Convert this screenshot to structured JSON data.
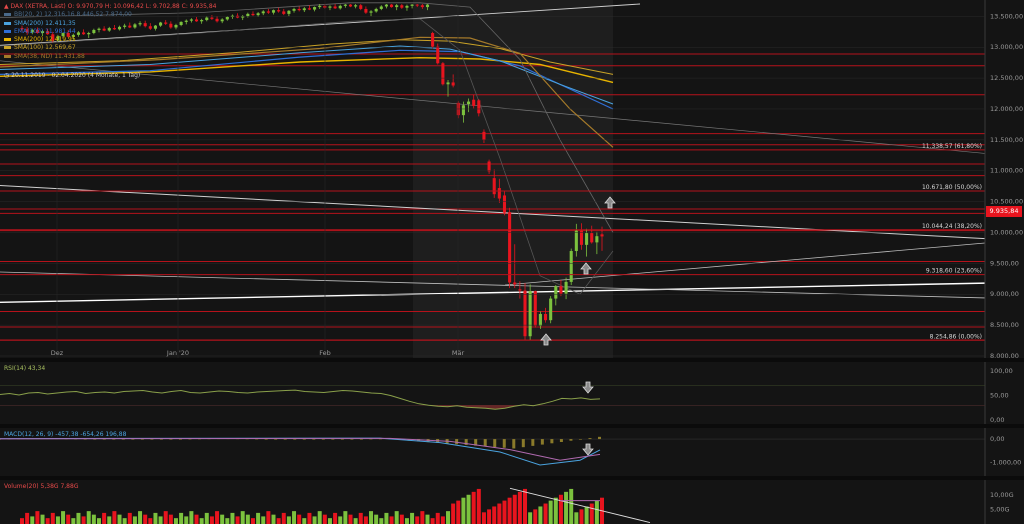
{
  "instrument_line": "DAX (XETRA, Last)  O: 9.970,79  H: 10.096,42  L: 9.702,88  C: 9.935,84",
  "legend": [
    {
      "label": "BB(20, 2)  12.316,16  8.446,52  7.874,00",
      "color": "#4a6a8a"
    },
    {
      "label": "SMA(200)  12.411,35",
      "color": "#4aa3df"
    },
    {
      "label": "EMA(100)  11.981,44",
      "color": "#2f6fd6"
    },
    {
      "label": "SMA(200)  12.419,95",
      "color": "#e8b400"
    },
    {
      "label": "SMA(100)  12.569,67",
      "color": "#c9a227"
    },
    {
      "label": "SMA(38, ND)  11.431,88",
      "color": "#a57a2a"
    }
  ],
  "period": "20.11.2019 - 02.04.2020   (4 Monate, 1 Tag)",
  "last_price": "9.935,84",
  "colors": {
    "up": "#7cc23e",
    "down": "#e8141e",
    "background": "#141414",
    "grid": "#2a2a2a",
    "hline": "#b5121b"
  },
  "chart_data": {
    "type": "candlestick",
    "y_axis_ticks": [
      "13.500,00",
      "13.000,00",
      "12.500,00",
      "12.000,00",
      "11.500,00",
      "11.000,00",
      "10.500,00",
      "10.000,00",
      "9.500,00",
      "9.000,00",
      "8.500,00",
      "8.000,00"
    ],
    "ylim": [
      8000,
      13700
    ],
    "x_axis_labels": [
      "Dez",
      "Jan '20",
      "Feb",
      "Mär"
    ],
    "fib_levels": [
      {
        "value": 11338.57,
        "label": "11.338,57 (61,80%)"
      },
      {
        "value": 10671.8,
        "label": "10.671,80 (50,00%)"
      },
      {
        "value": 10044.24,
        "label": "10.044,24 (38,20%)"
      },
      {
        "value": 9318.6,
        "label": "9.318,60 (23,60%)"
      },
      {
        "value": 8254.86,
        "label": "8.254,86 (0,00%)"
      }
    ],
    "support_resistance_levels": [
      12890,
      12700,
      12230,
      11600,
      11420,
      11110,
      10920,
      10380,
      10310,
      10030,
      9530,
      8720,
      8470,
      8260
    ],
    "candles": [
      {
        "o": 13310,
        "h": 13350,
        "l": 13250,
        "c": 13290
      },
      {
        "o": 13290,
        "h": 13330,
        "l": 13200,
        "c": 13240
      },
      {
        "o": 13240,
        "h": 13300,
        "l": 13210,
        "c": 13280
      },
      {
        "o": 13280,
        "h": 13320,
        "l": 13220,
        "c": 13230
      },
      {
        "o": 13230,
        "h": 13280,
        "l": 13180,
        "c": 13260
      },
      {
        "o": 13260,
        "h": 13300,
        "l": 13200,
        "c": 13210
      },
      {
        "o": 13210,
        "h": 13250,
        "l": 13080,
        "c": 13110
      },
      {
        "o": 13110,
        "h": 13200,
        "l": 13090,
        "c": 13180
      },
      {
        "o": 13180,
        "h": 13240,
        "l": 13150,
        "c": 13230
      },
      {
        "o": 13230,
        "h": 13280,
        "l": 13160,
        "c": 13170
      },
      {
        "o": 13170,
        "h": 13220,
        "l": 13120,
        "c": 13200
      },
      {
        "o": 13200,
        "h": 13260,
        "l": 13170,
        "c": 13240
      },
      {
        "o": 13240,
        "h": 13290,
        "l": 13200,
        "c": 13210
      },
      {
        "o": 13210,
        "h": 13250,
        "l": 13150,
        "c": 13230
      },
      {
        "o": 13230,
        "h": 13300,
        "l": 13210,
        "c": 13280
      },
      {
        "o": 13280,
        "h": 13320,
        "l": 13240,
        "c": 13300
      },
      {
        "o": 13300,
        "h": 13340,
        "l": 13260,
        "c": 13270
      },
      {
        "o": 13270,
        "h": 13330,
        "l": 13250,
        "c": 13310
      },
      {
        "o": 13310,
        "h": 13360,
        "l": 13280,
        "c": 13290
      },
      {
        "o": 13290,
        "h": 13350,
        "l": 13270,
        "c": 13330
      },
      {
        "o": 13330,
        "h": 13380,
        "l": 13300,
        "c": 13350
      },
      {
        "o": 13350,
        "h": 13400,
        "l": 13310,
        "c": 13320
      },
      {
        "o": 13320,
        "h": 13390,
        "l": 13300,
        "c": 13370
      },
      {
        "o": 13370,
        "h": 13420,
        "l": 13340,
        "c": 13390
      },
      {
        "o": 13390,
        "h": 13430,
        "l": 13320,
        "c": 13340
      },
      {
        "o": 13340,
        "h": 13390,
        "l": 13280,
        "c": 13300
      },
      {
        "o": 13300,
        "h": 13360,
        "l": 13270,
        "c": 13350
      },
      {
        "o": 13350,
        "h": 13410,
        "l": 13330,
        "c": 13400
      },
      {
        "o": 13400,
        "h": 13440,
        "l": 13360,
        "c": 13380
      },
      {
        "o": 13380,
        "h": 13420,
        "l": 13300,
        "c": 13320
      },
      {
        "o": 13320,
        "h": 13380,
        "l": 13290,
        "c": 13360
      },
      {
        "o": 13360,
        "h": 13420,
        "l": 13340,
        "c": 13410
      },
      {
        "o": 13410,
        "h": 13450,
        "l": 13370,
        "c": 13430
      },
      {
        "o": 13430,
        "h": 13470,
        "l": 13400,
        "c": 13450
      },
      {
        "o": 13450,
        "h": 13490,
        "l": 13410,
        "c": 13420
      },
      {
        "o": 13420,
        "h": 13460,
        "l": 13380,
        "c": 13440
      },
      {
        "o": 13440,
        "h": 13500,
        "l": 13420,
        "c": 13480
      },
      {
        "o": 13480,
        "h": 13520,
        "l": 13440,
        "c": 13460
      },
      {
        "o": 13460,
        "h": 13500,
        "l": 13400,
        "c": 13420
      },
      {
        "o": 13420,
        "h": 13470,
        "l": 13390,
        "c": 13450
      },
      {
        "o": 13450,
        "h": 13500,
        "l": 13430,
        "c": 13490
      },
      {
        "o": 13490,
        "h": 13530,
        "l": 13460,
        "c": 13510
      },
      {
        "o": 13510,
        "h": 13550,
        "l": 13470,
        "c": 13480
      },
      {
        "o": 13480,
        "h": 13520,
        "l": 13440,
        "c": 13500
      },
      {
        "o": 13500,
        "h": 13560,
        "l": 13480,
        "c": 13540
      },
      {
        "o": 13540,
        "h": 13580,
        "l": 13500,
        "c": 13520
      },
      {
        "o": 13520,
        "h": 13570,
        "l": 13490,
        "c": 13550
      },
      {
        "o": 13550,
        "h": 13600,
        "l": 13520,
        "c": 13580
      },
      {
        "o": 13580,
        "h": 13620,
        "l": 13540,
        "c": 13560
      },
      {
        "o": 13560,
        "h": 13610,
        "l": 13530,
        "c": 13600
      },
      {
        "o": 13600,
        "h": 13640,
        "l": 13560,
        "c": 13580
      },
      {
        "o": 13580,
        "h": 13620,
        "l": 13520,
        "c": 13540
      },
      {
        "o": 13540,
        "h": 13600,
        "l": 13500,
        "c": 13590
      },
      {
        "o": 13590,
        "h": 13640,
        "l": 13560,
        "c": 13620
      },
      {
        "o": 13620,
        "h": 13660,
        "l": 13580,
        "c": 13600
      },
      {
        "o": 13600,
        "h": 13650,
        "l": 13570,
        "c": 13630
      },
      {
        "o": 13630,
        "h": 13680,
        "l": 13600,
        "c": 13610
      },
      {
        "o": 13610,
        "h": 13660,
        "l": 13580,
        "c": 13650
      },
      {
        "o": 13650,
        "h": 13700,
        "l": 13620,
        "c": 13670
      },
      {
        "o": 13670,
        "h": 13700,
        "l": 13620,
        "c": 13640
      },
      {
        "o": 13640,
        "h": 13680,
        "l": 13600,
        "c": 13660
      },
      {
        "o": 13660,
        "h": 13700,
        "l": 13620,
        "c": 13630
      },
      {
        "o": 13630,
        "h": 13690,
        "l": 13610,
        "c": 13670
      },
      {
        "o": 13670,
        "h": 13700,
        "l": 13640,
        "c": 13690
      },
      {
        "o": 13690,
        "h": 13700,
        "l": 13650,
        "c": 13660
      },
      {
        "o": 13660,
        "h": 13700,
        "l": 13630,
        "c": 13680
      },
      {
        "o": 13680,
        "h": 13700,
        "l": 13600,
        "c": 13620
      },
      {
        "o": 13620,
        "h": 13660,
        "l": 13540,
        "c": 13560
      },
      {
        "o": 13560,
        "h": 13600,
        "l": 13500,
        "c": 13580
      },
      {
        "o": 13580,
        "h": 13640,
        "l": 13560,
        "c": 13620
      },
      {
        "o": 13620,
        "h": 13680,
        "l": 13600,
        "c": 13660
      },
      {
        "o": 13660,
        "h": 13700,
        "l": 13630,
        "c": 13690
      },
      {
        "o": 13690,
        "h": 13700,
        "l": 13640,
        "c": 13650
      },
      {
        "o": 13650,
        "h": 13700,
        "l": 13600,
        "c": 13680
      },
      {
        "o": 13680,
        "h": 13700,
        "l": 13620,
        "c": 13640
      },
      {
        "o": 13640,
        "h": 13690,
        "l": 13590,
        "c": 13670
      },
      {
        "o": 13670,
        "h": 13700,
        "l": 13630,
        "c": 13690
      },
      {
        "o": 13690,
        "h": 13700,
        "l": 13650,
        "c": 13680
      },
      {
        "o": 13680,
        "h": 13700,
        "l": 13620,
        "c": 13650
      },
      {
        "o": 13650,
        "h": 13700,
        "l": 13600,
        "c": 13690
      },
      {
        "o": 13230,
        "h": 13250,
        "l": 12980,
        "c": 13010
      },
      {
        "o": 13010,
        "h": 13060,
        "l": 12720,
        "c": 12740
      },
      {
        "o": 12740,
        "h": 12760,
        "l": 12380,
        "c": 12400
      },
      {
        "o": 12400,
        "h": 12470,
        "l": 12200,
        "c": 12430
      },
      {
        "o": 12430,
        "h": 12560,
        "l": 12350,
        "c": 12380
      },
      {
        "o": 12100,
        "h": 12130,
        "l": 11850,
        "c": 11900
      },
      {
        "o": 11900,
        "h": 12120,
        "l": 11780,
        "c": 12060
      },
      {
        "o": 12080,
        "h": 12170,
        "l": 11950,
        "c": 12120
      },
      {
        "o": 12150,
        "h": 12230,
        "l": 12010,
        "c": 12050
      },
      {
        "o": 12140,
        "h": 12160,
        "l": 11880,
        "c": 11930
      },
      {
        "o": 11630,
        "h": 11670,
        "l": 11450,
        "c": 11500
      },
      {
        "o": 11150,
        "h": 11180,
        "l": 10950,
        "c": 10990
      },
      {
        "o": 10880,
        "h": 11020,
        "l": 10560,
        "c": 10620
      },
      {
        "o": 10720,
        "h": 10870,
        "l": 10480,
        "c": 10550
      },
      {
        "o": 10600,
        "h": 10680,
        "l": 10280,
        "c": 10320
      },
      {
        "o": 10330,
        "h": 10400,
        "l": 9100,
        "c": 9190
      },
      {
        "o": 9190,
        "h": 9810,
        "l": 9100,
        "c": 9160
      },
      {
        "o": 9080,
        "h": 9210,
        "l": 8930,
        "c": 9060
      },
      {
        "o": 9060,
        "h": 9180,
        "l": 8250,
        "c": 8320
      },
      {
        "o": 8320,
        "h": 9160,
        "l": 8260,
        "c": 9050
      },
      {
        "o": 9050,
        "h": 9060,
        "l": 8460,
        "c": 8490
      },
      {
        "o": 8490,
        "h": 8720,
        "l": 8440,
        "c": 8680
      },
      {
        "o": 8680,
        "h": 8780,
        "l": 8540,
        "c": 8580
      },
      {
        "o": 8580,
        "h": 8970,
        "l": 8530,
        "c": 8930
      },
      {
        "o": 8930,
        "h": 9150,
        "l": 8820,
        "c": 9130
      },
      {
        "o": 9130,
        "h": 9230,
        "l": 8970,
        "c": 9010
      },
      {
        "o": 9010,
        "h": 9270,
        "l": 8920,
        "c": 9200
      },
      {
        "o": 9200,
        "h": 9740,
        "l": 9150,
        "c": 9700
      },
      {
        "o": 9700,
        "h": 10140,
        "l": 9610,
        "c": 10030
      },
      {
        "o": 10030,
        "h": 10150,
        "l": 9720,
        "c": 9800
      },
      {
        "o": 9800,
        "h": 10060,
        "l": 9610,
        "c": 9990
      },
      {
        "o": 9990,
        "h": 10110,
        "l": 9820,
        "c": 9840
      },
      {
        "o": 9840,
        "h": 10010,
        "l": 9650,
        "c": 9940
      },
      {
        "o": 9970,
        "h": 10096,
        "l": 9703,
        "c": 9936
      }
    ],
    "rsi": {
      "label": "RSI(14)  43,34",
      "ticks": [
        "100,00",
        "50,00",
        "0,00"
      ],
      "ylim": [
        0,
        110
      ]
    },
    "macd": {
      "label": "MACD(12, 26, 9)  -457,38  -654,26  196,88",
      "ticks": [
        "0,00",
        "-1.000,00"
      ],
      "ylim": [
        -1400,
        300
      ]
    },
    "volume": {
      "label": "Volume(20)  5,38G  7,88G",
      "ticks": [
        "10,00G",
        "5,00G"
      ],
      "ylim": [
        0,
        13
      ]
    }
  }
}
